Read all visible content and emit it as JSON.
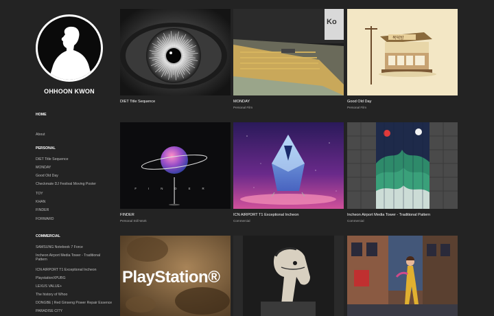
{
  "site": {
    "name": "OHHOON KWON"
  },
  "nav": {
    "home": "HOME",
    "about": "About",
    "personal_head": "PERSONAL",
    "personal": [
      "DIET Title Sequence",
      "MONDAY",
      "Good Old Day",
      "Checkmate DJ Festival Moving Poster",
      "TOY",
      "KHAN",
      "FINDER",
      "FORWARD"
    ],
    "commercial_head": "COMMERCIAL",
    "commercial": [
      "SAMSUNG Notebook 7 Force",
      "Incheon Airport Media Tower - Traditional Pattern",
      "ICN AIRPORT T1 Exceptional Incheon",
      "PlaystationXPUBG",
      "LEXUS VALUE+",
      "The history of Whoo",
      "DONGBE | Red Ginseng Power Repair Essence",
      "PARADISE CITY"
    ]
  },
  "tiles": [
    {
      "title": "DIET Title Sequence",
      "sub": ""
    },
    {
      "title": "MONDAY",
      "sub": "Personal Film"
    },
    {
      "title": "Good Old Day",
      "sub": "Personal Film"
    },
    {
      "title": "FINDER",
      "sub": "Personal Still Work"
    },
    {
      "title": "ICN AIRPORT T1 Exceptional Incheon",
      "sub": "Commercial"
    },
    {
      "title": "Incheon Airport Media Tower - Traditional Pattern",
      "sub": "Commercial"
    },
    {
      "title": "",
      "sub": ""
    },
    {
      "title": "",
      "sub": ""
    },
    {
      "title": "",
      "sub": ""
    }
  ],
  "thumb_text": {
    "playstation": "PlayStation®",
    "finder": "FINDER",
    "shop_sign": "복덕방",
    "monday_sign": "Ko"
  }
}
